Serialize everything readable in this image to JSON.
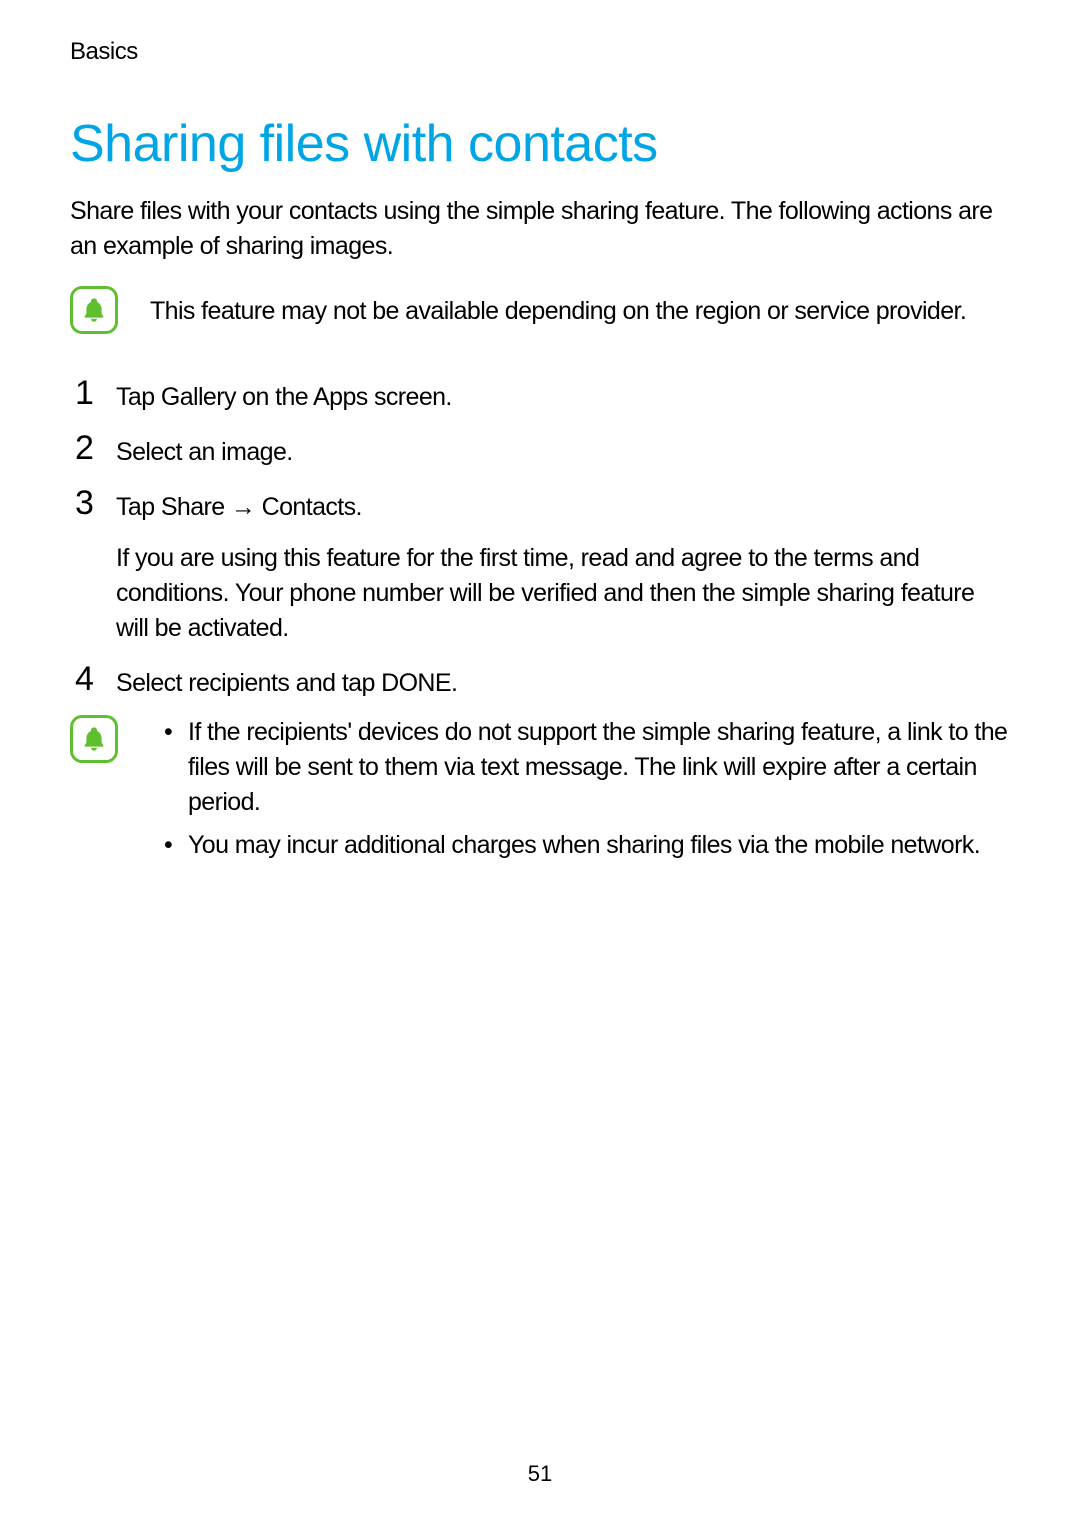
{
  "header": {
    "breadcrumb": "Basics"
  },
  "main": {
    "title": "Sharing files with contacts",
    "intro": "Share files with your contacts using the simple sharing feature. The following actions are an example of sharing images.",
    "note1": {
      "text": "This feature may not be available depending on the region or service provider."
    },
    "steps": [
      {
        "number": "1",
        "text": "Tap Gallery on the Apps screen."
      },
      {
        "number": "2",
        "text": "Select an image."
      },
      {
        "number": "3",
        "text": "Tap Share → Contacts.",
        "subtext": "If you are using this feature for the first time, read and agree to the terms and conditions. Your phone number will be verified and then the simple sharing feature will be activated."
      },
      {
        "number": "4",
        "text": "Select recipients and tap DONE."
      }
    ],
    "note2": {
      "bullets": [
        "If the recipients' devices do not support the simple sharing feature, a link to the files will be sent to them via text message. The link will expire after a certain period.",
        "You may incur additional charges when sharing files via the mobile network."
      ]
    }
  },
  "footer": {
    "page_number": "51"
  },
  "colors": {
    "title_blue": "#00a5e5",
    "icon_green": "#5fbf2f"
  }
}
